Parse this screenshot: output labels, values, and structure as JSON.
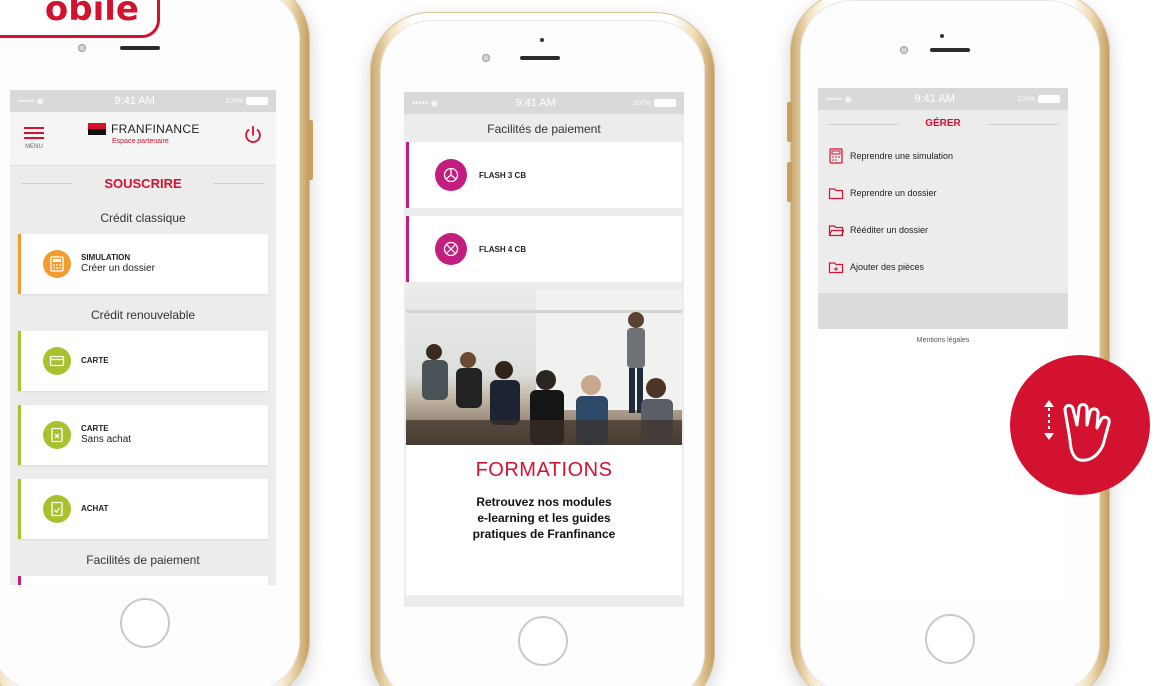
{
  "badge": {
    "text": "obile"
  },
  "status": {
    "time": "9:41 AM",
    "signal": "••••• ◉",
    "battery": "100%"
  },
  "phone1": {
    "menu_label": "MENU",
    "brand": "FRANFINANCE",
    "brand_sub": "Espace partenaire",
    "section": "SOUSCRIRE",
    "credit_classique": "Crédit classique",
    "simulation_title": "SIMULATION",
    "simulation_sub": "Créer un dossier",
    "credit_renouvelable": "Crédit renouvelable",
    "carte": "CARTE",
    "carte_sa_title": "CARTE",
    "carte_sa_sub": "Sans achat",
    "achat": "ACHAT",
    "facilites": "Facilités de paiement"
  },
  "phone2": {
    "title": "Facilités de paiement",
    "flash3": "FLASH 3 CB",
    "flash4": "FLASH 4 CB",
    "formations": "FORMATIONS",
    "desc_line1": "Retrouvez nos modules",
    "desc_line2": "e-learning et les guides",
    "desc_line3": "pratiques de Franfinance"
  },
  "phone3": {
    "section": "GÉRER",
    "item1": "Reprendre une simulation",
    "item2": "Reprendre un dossier",
    "item3": "Rééditer un dossier",
    "item4": "Ajouter des pièces",
    "legal": "Mentions légales"
  },
  "colors": {
    "brand_red": "#d3122f",
    "green": "#a7c22e",
    "orange": "#f29b30",
    "magenta": "#c21e7f"
  },
  "icons": [
    "menu-icon",
    "power-icon",
    "calculator-icon",
    "card-icon",
    "document-icon",
    "piechart-icon",
    "folder-icon",
    "swipe-hand-icon"
  ]
}
